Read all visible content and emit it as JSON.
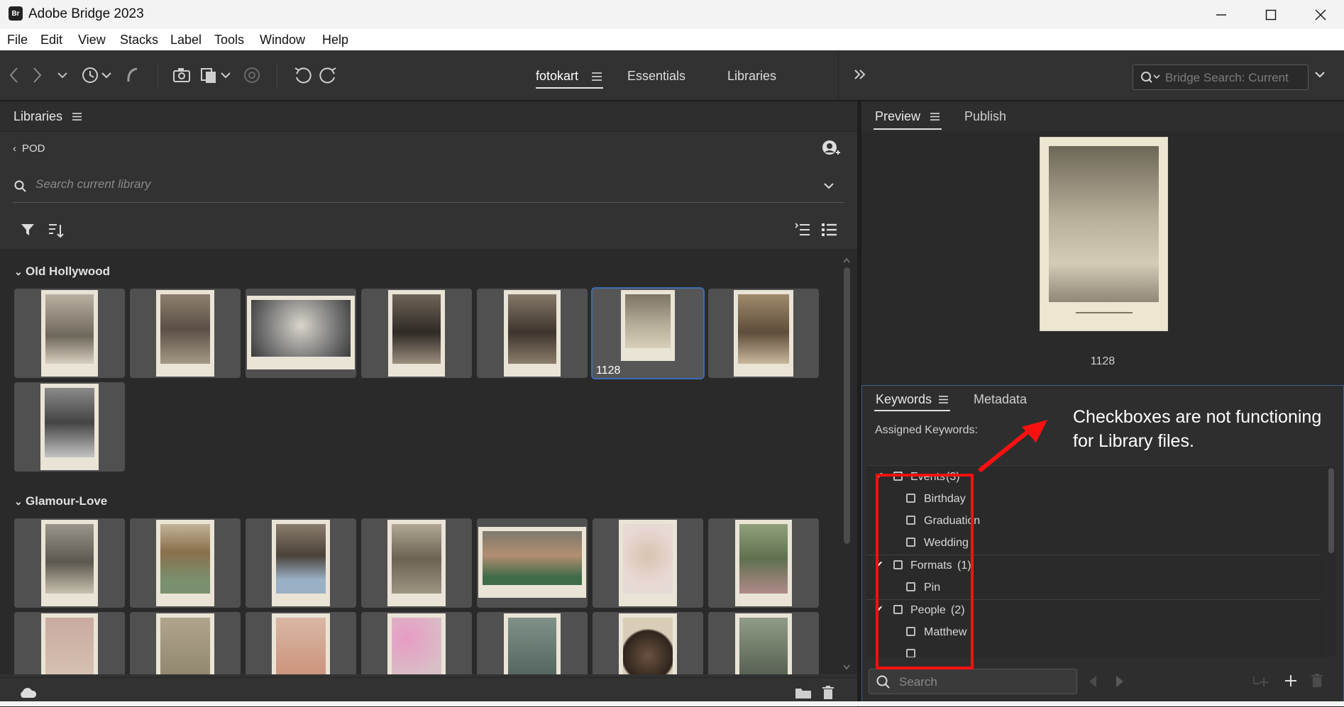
{
  "window": {
    "app_icon_text": "Br",
    "title": "Adobe Bridge 2023"
  },
  "menu": [
    "File",
    "Edit",
    "View",
    "Stacks",
    "Label",
    "Tools",
    "Window",
    "Help"
  ],
  "toolbar": {
    "workspaces": [
      "fotokart",
      "Essentials",
      "Libraries"
    ],
    "search_placeholder": "Bridge Search: Current"
  },
  "libraries_panel": {
    "title": "Libraries",
    "back_label": "POD",
    "search_placeholder": "Search current library",
    "groups": [
      {
        "name": "Old Hollywood",
        "selected_label": "1128"
      },
      {
        "name": "Glamour-Love"
      }
    ]
  },
  "preview_panel": {
    "tabs": [
      "Preview",
      "Publish"
    ],
    "caption": "1128"
  },
  "keywords_panel": {
    "tabs": [
      "Keywords",
      "Metadata"
    ],
    "assigned_label": "Assigned Keywords:",
    "items": [
      {
        "label": "Events",
        "count": "(3)",
        "level": 0,
        "expanded": true
      },
      {
        "label": "Birthday",
        "level": 1
      },
      {
        "label": "Graduation",
        "level": 1
      },
      {
        "label": "Wedding",
        "level": 1
      },
      {
        "label": "Formats",
        "count": "(1)",
        "level": 0,
        "expanded": true
      },
      {
        "label": "Pin",
        "level": 1
      },
      {
        "label": "People",
        "count": "(2)",
        "level": 0,
        "expanded": true
      },
      {
        "label": "Matthew",
        "level": 1
      }
    ],
    "search_placeholder": "Search"
  },
  "annotation": {
    "text": "Checkboxes are not functioning for Library files.",
    "color": "#ff1010"
  },
  "colors": {
    "panel_bg": "#323232",
    "selection_outline": "#3d6db5"
  }
}
